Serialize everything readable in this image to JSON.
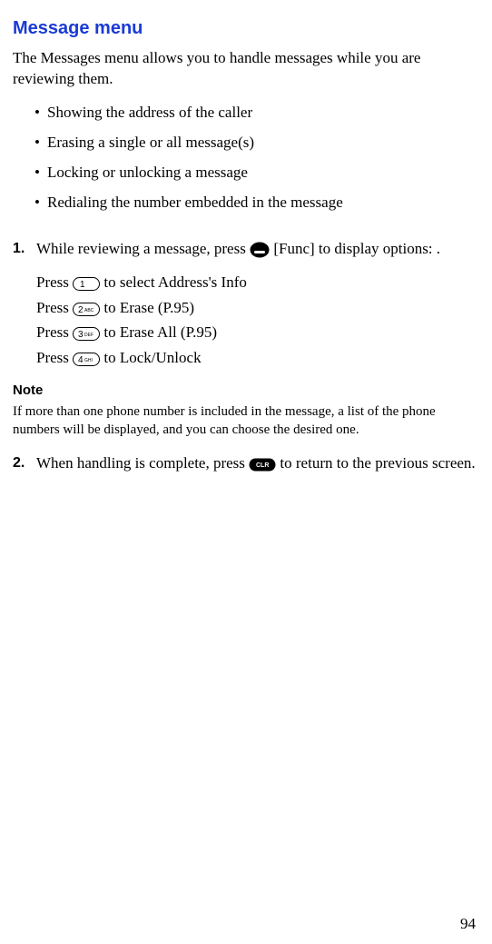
{
  "heading": "Message menu",
  "intro": "The Messages menu allows you to handle messages while you are reviewing them.",
  "bullets": [
    "Showing the address of the caller",
    "Erasing a single or all message(s)",
    "Locking or unlocking a message",
    "Redialing the number embedded in the message"
  ],
  "step1": {
    "num": "1.",
    "text_a": "While reviewing a message, press ",
    "text_b": " [Func] to display options: ."
  },
  "presslines": [
    {
      "pre": "Press ",
      "post": " to select Address's Info"
    },
    {
      "pre": "Press ",
      "post": " to Erase (P.95)"
    },
    {
      "pre": "Press ",
      "post": " to Erase All (P.95)"
    },
    {
      "pre": "Press ",
      "post": " to Lock/Unlock"
    }
  ],
  "note": {
    "label": "Note",
    "text": "If more than one phone number is included in the message, a list of the phone numbers will be displayed, and you can choose the desired one."
  },
  "step2": {
    "num": "2.",
    "text_a": "When handling is complete, press ",
    "text_b": " to return to the previous screen."
  },
  "page_number": "94"
}
